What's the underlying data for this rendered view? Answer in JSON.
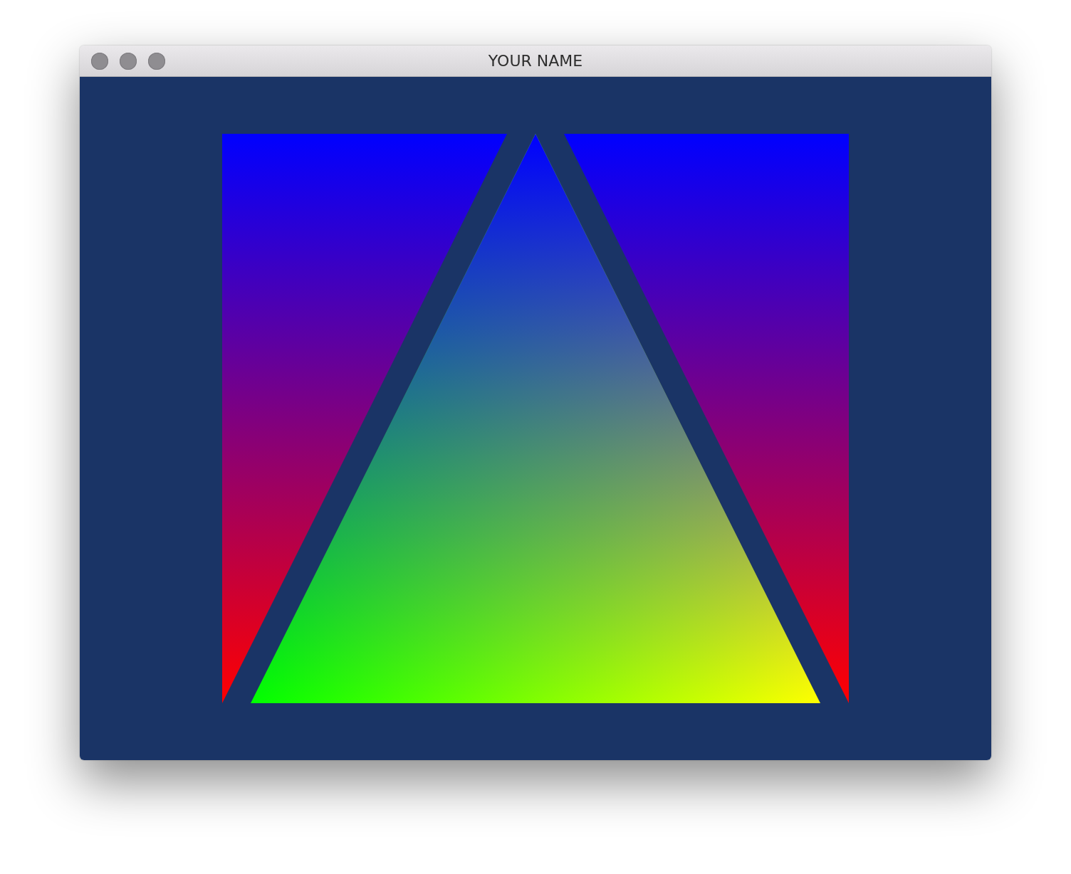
{
  "window": {
    "title": "YOUR NAME"
  }
}
